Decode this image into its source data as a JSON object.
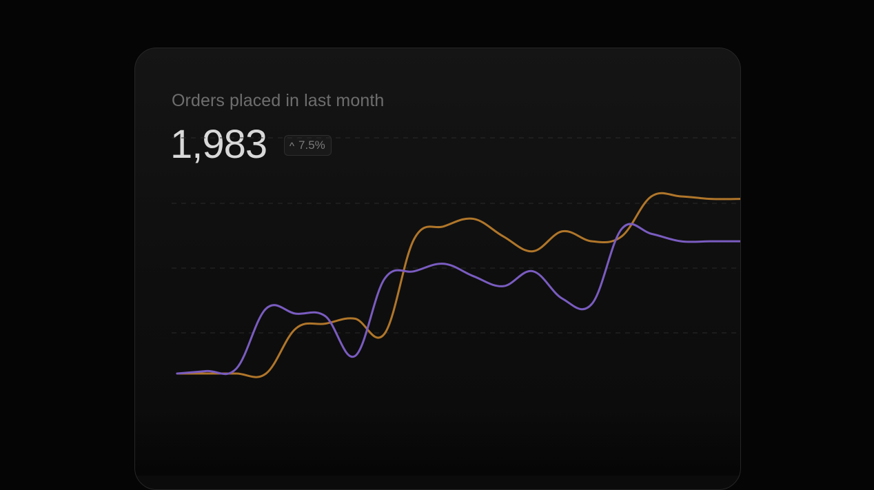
{
  "card": {
    "title": "Orders placed in last month",
    "value": "1,983",
    "change": {
      "icon": "chevron-up-icon",
      "glyph": "^",
      "text": "7.5%"
    }
  },
  "colors": {
    "background": "#050505",
    "card": "#121212",
    "series_orange": "#b0762a",
    "series_purple": "#7a5cc0",
    "grid": "#2a2a2a"
  },
  "chart_data": {
    "type": "line",
    "grid": true,
    "ylim": [
      0,
      100
    ],
    "x": [
      0,
      1,
      2,
      3,
      4,
      5,
      6,
      7,
      8,
      9,
      10,
      11,
      12,
      13,
      14,
      15,
      16,
      17,
      18,
      19
    ],
    "series": [
      {
        "key": "orange",
        "values": [
          0,
          0,
          0,
          0,
          18,
          20,
          22,
          16,
          54,
          59,
          62,
          55,
          49,
          57,
          53,
          55,
          71,
          71,
          70,
          70
        ]
      },
      {
        "key": "purple",
        "values": [
          0,
          1,
          2,
          26,
          24,
          23,
          7,
          38,
          41,
          44,
          39,
          35,
          41,
          30,
          28,
          58,
          56,
          53,
          53,
          53
        ]
      }
    ]
  }
}
